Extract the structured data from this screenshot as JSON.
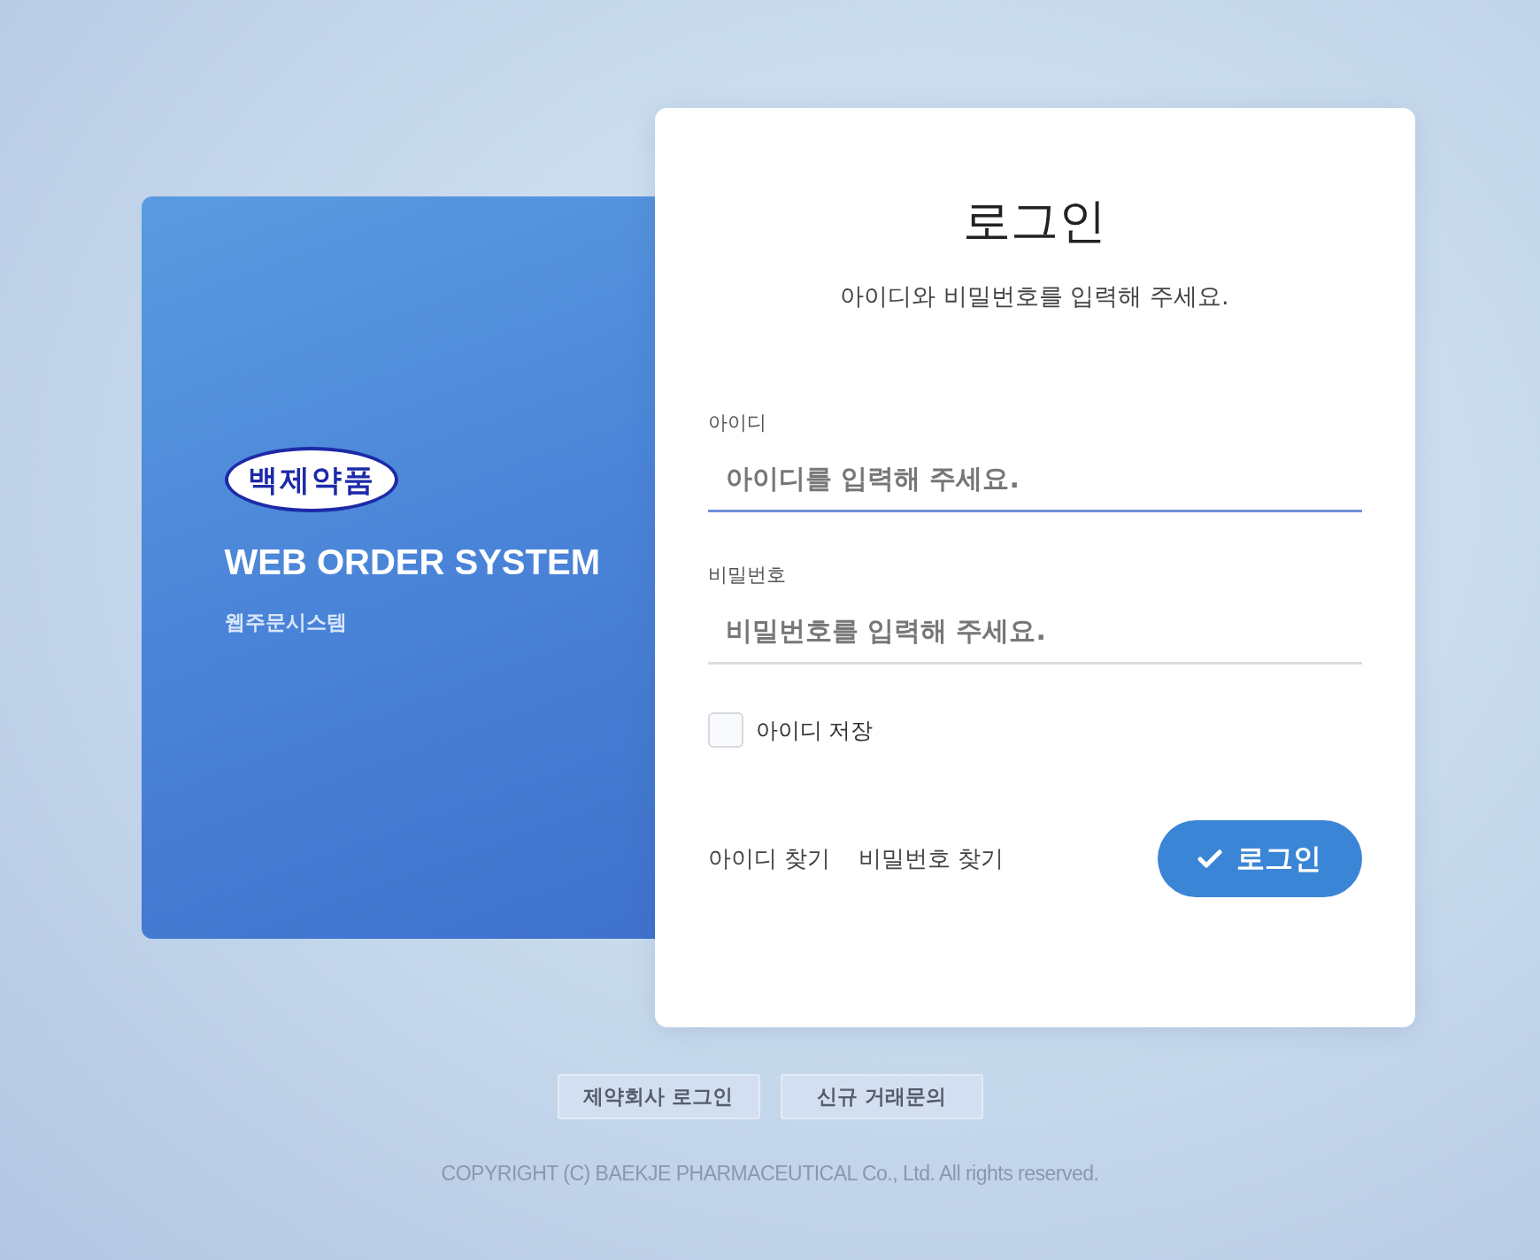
{
  "brand": {
    "logo_text": "백제약품",
    "title": "WEB ORDER SYSTEM",
    "subtitle": "웹주문시스템"
  },
  "login": {
    "title": "로그인",
    "instruction": "아이디와 비밀번호를 입력해 주세요.",
    "fields": [
      {
        "label": "아이디",
        "placeholder": "아이디를 입력해 주세요.",
        "focused": true
      },
      {
        "label": "비밀번호",
        "placeholder": "비밀번호를 입력해 주세요.",
        "focused": false
      }
    ],
    "remember": {
      "label": "아이디 저장",
      "checked": false
    },
    "links": [
      "아이디 찾기",
      "비밀번호 찾기"
    ],
    "submit": "로그인"
  },
  "footer_buttons": [
    "제약회사 로그인",
    "신규 거래문의"
  ],
  "copyright": "COPYRIGHT (C) BAEKJE PHARMACEUTICAL Co., Ltd. All rights reserved."
}
